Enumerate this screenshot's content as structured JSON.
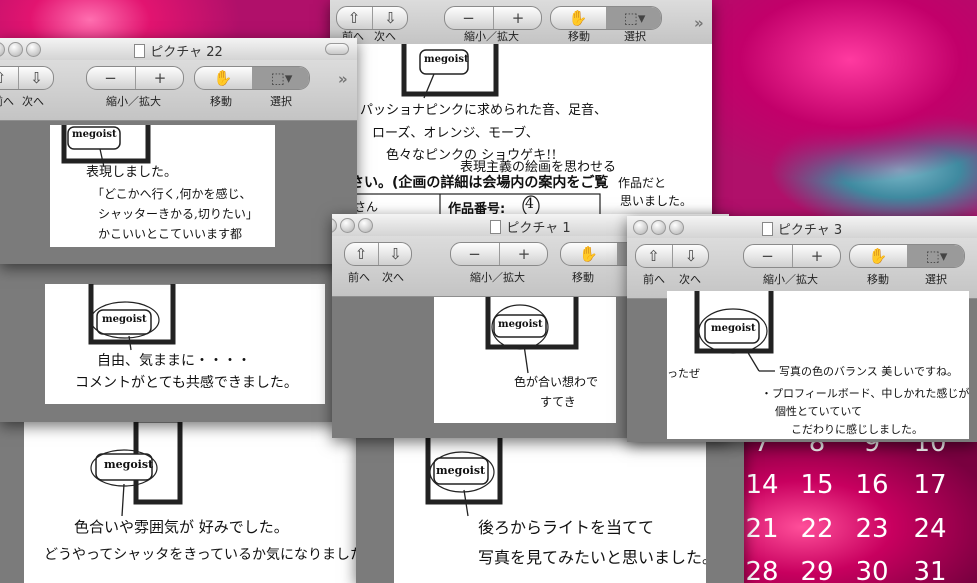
{
  "toolbar": {
    "prev": "前へ",
    "next": "次へ",
    "zoom": "縮小／拡大",
    "move": "移動",
    "select": "選択",
    "minus": "−",
    "plus": "+"
  },
  "windows": {
    "w22": {
      "title": "ピクチャ 22"
    },
    "w1": {
      "title": "ピクチャ 1"
    },
    "w3": {
      "title": "ピクチャ 3"
    }
  },
  "logo": "megoist",
  "calendar": {
    "row0": [
      "7",
      "8",
      "9",
      "10"
    ],
    "row1": [
      "14",
      "15",
      "16",
      "17"
    ],
    "row2": [
      "21",
      "22",
      "23",
      "24"
    ],
    "row3": [
      "28",
      "29",
      "30",
      "31"
    ]
  },
  "notes": {
    "top_1": "パッショナピンクに求められた音、足音、",
    "top_2": "ローズ、オレンジ、モーブ、",
    "top_3": "色々なピンクの ショウゲキ!!",
    "top_4": "表現主義の絵画を思わせる",
    "top_5": "ださい。(企画の詳細は会場内の案内をご覧",
    "top_6": "作品だと",
    "top_7": "思いました。",
    "top_8": "さん",
    "top_9": "作品番号:",
    "top_10": "4",
    "w22_1": "表現しました。",
    "w22_2": "「どこかへ行く,何かを感じ、",
    "w22_3": "シャッターきかる,切りたい」",
    "w22_4": "かこいいとこていいます都",
    "mid_1": "自由、気ままに・・・・",
    "mid_2": "コメントがとても共感できました。",
    "w1_1": "色が合い想わで",
    "w1_2": "すてき",
    "w3_0": "ったぜ",
    "w3_1": "写真の色のバランス 美しいですね。",
    "w3_2": "・プロフィールボード、中しかれた感じが",
    "w3_3": "個性とていていて",
    "w3_4": "こだわりに感じしました。",
    "bl_1": "色合いや雰囲気が 好みでした。",
    "bl_2": "どうやってシャッタをきっているか気になりました。",
    "bm_1": "後ろからライトを当てて",
    "bm_2": "写真を見てみたいと思いました。"
  }
}
